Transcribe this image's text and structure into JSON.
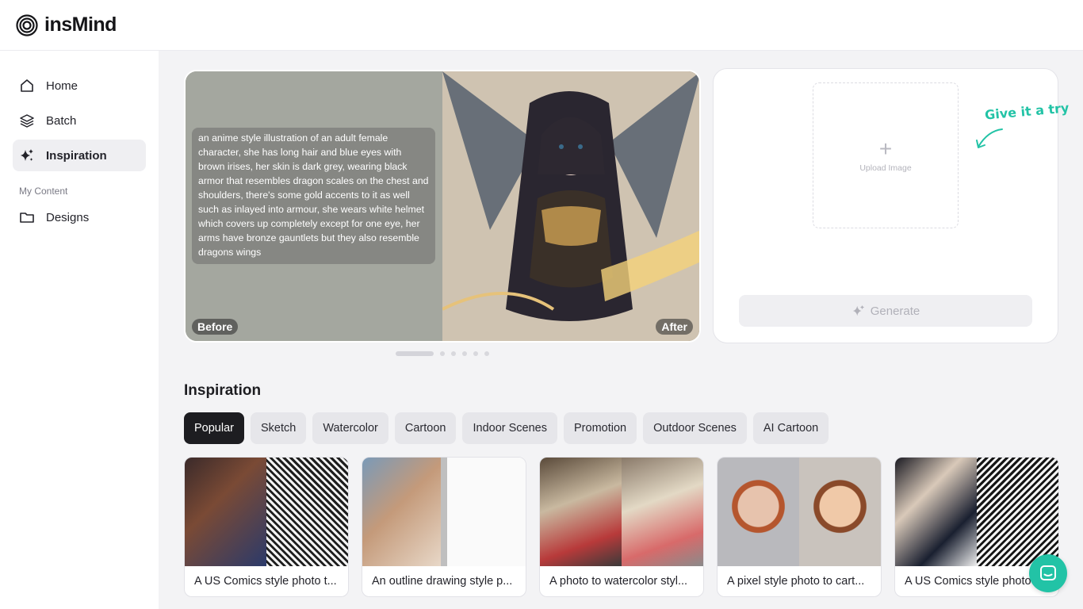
{
  "app": {
    "name": "insMind"
  },
  "sidebar": {
    "items": [
      {
        "label": "Home",
        "icon": "home-icon"
      },
      {
        "label": "Batch",
        "icon": "layers-icon"
      },
      {
        "label": "Inspiration",
        "icon": "sparkle-icon",
        "active": true
      }
    ],
    "section_label": "My Content",
    "content_items": [
      {
        "label": "Designs",
        "icon": "folder-icon"
      }
    ]
  },
  "hero": {
    "prompt": "an anime style illustration of an adult female character, she has long hair and blue eyes with brown irises, her skin is dark grey, wearing black armor that resembles dragon scales on the chest and shoulders, there's some gold accents to it as well such as inlayed into armour, she wears white helmet which covers up completely except for one eye, her arms have bronze gauntlets but they also resemble dragons wings",
    "before_label": "Before",
    "after_label": "After",
    "slides_total": 6,
    "active_slide": 1
  },
  "upload": {
    "label": "Upload Image",
    "callout": "Give it a try",
    "generate_label": "Generate"
  },
  "inspiration": {
    "title": "Inspiration",
    "categories": [
      "Popular",
      "Sketch",
      "Watercolor",
      "Cartoon",
      "Indoor Scenes",
      "Promotion",
      "Outdoor Scenes",
      "AI Cartoon"
    ],
    "active_category": "Popular",
    "cards": [
      {
        "caption": "A US Comics style photo t..."
      },
      {
        "caption": "An outline drawing style p..."
      },
      {
        "caption": "A photo to watercolor styl..."
      },
      {
        "caption": "A pixel style photo to cart..."
      },
      {
        "caption": "A US Comics style photo"
      }
    ]
  },
  "colors": {
    "accent": "#22c3a6",
    "active_chip": "#1d1d21"
  }
}
